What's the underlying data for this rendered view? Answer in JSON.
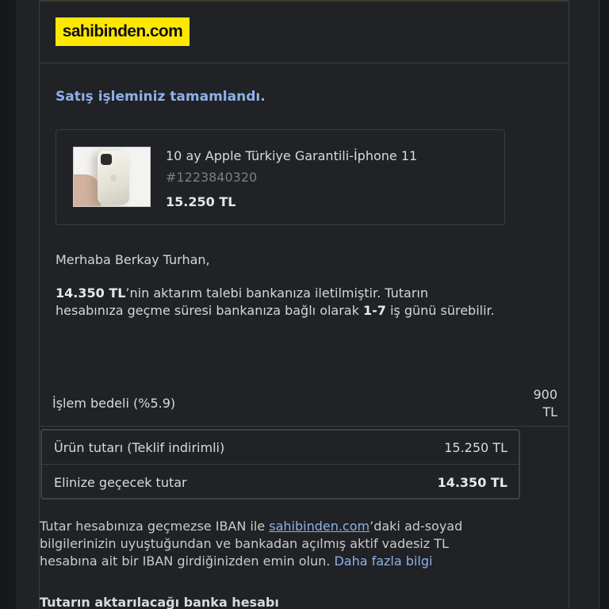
{
  "header": {
    "logo_text": "sahibinden.com",
    "logo_color": "#ffe800"
  },
  "headline": "Satış işleminiz tamamlandı.",
  "product": {
    "title": "10 ay Apple Türkiye Garantili-İphone 11",
    "id": "#1223840320",
    "price": "15.250 TL"
  },
  "greeting": "Merhaba Berkay Turhan,",
  "message": {
    "amount": "14.350 TL",
    "text_1": "’nin aktarım talebi bankanıza iletilmiştir. Tutarın hesabınıza geçme süresi bankanıza bağlı olarak ",
    "days": "1-7",
    "text_2": " iş günü sürebilir."
  },
  "fee": {
    "label": "İşlem bedeli (%5.9)",
    "value": "900 TL"
  },
  "summary": {
    "rows": [
      {
        "label": "Ürün tutarı (Teklif indirimli)",
        "value": "15.250 TL"
      },
      {
        "label": "Elinize geçecek tutar",
        "value": "14.350 TL"
      }
    ]
  },
  "note": {
    "text_1": "Tutar hesabınıza geçmezse IBAN ile ",
    "link": "sahibinden.com",
    "text_2": "’daki ad-soyad bilgilerinizin uyuştuğundan ve bankadan açılmış aktif vadesiz TL hesabına ait bir IBAN girdiğinizden emin olun. ",
    "more_link": "Daha fazla bilgi"
  },
  "bank_section_title": "Tutarın aktarılacağı banka hesabı",
  "colors": {
    "background": "#202226",
    "accent_link": "#8fb1e8"
  }
}
